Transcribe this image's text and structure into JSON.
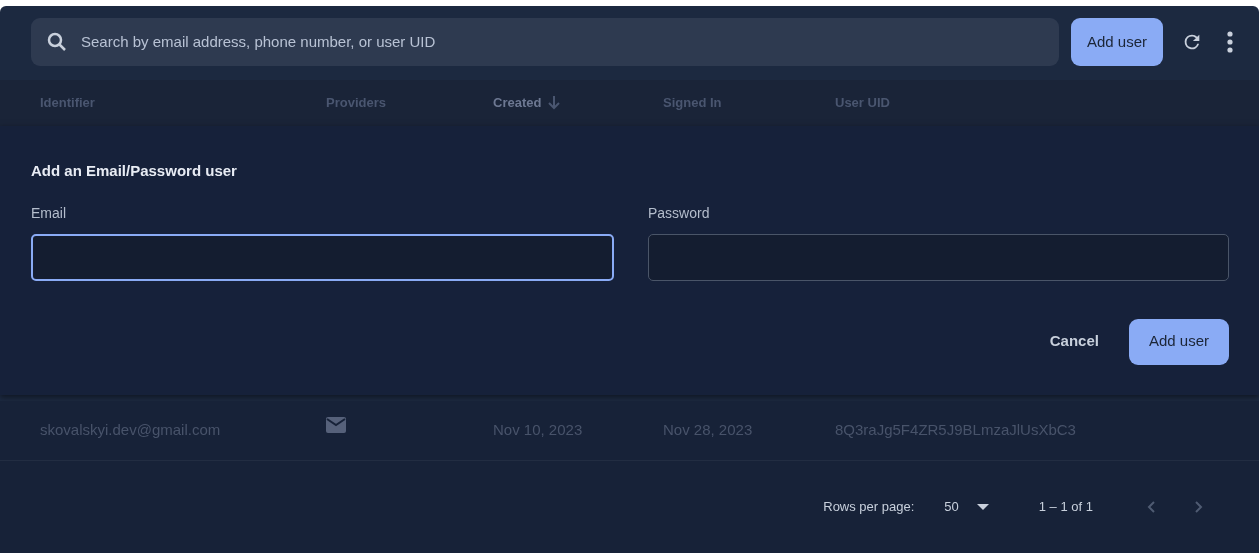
{
  "search": {
    "placeholder": "Search by email address, phone number, or user UID"
  },
  "toolbar": {
    "add_button": "Add user"
  },
  "table": {
    "columns": [
      {
        "label": "Identifier",
        "sorted": false
      },
      {
        "label": "Providers",
        "sorted": false
      },
      {
        "label": "Created",
        "sorted": true
      },
      {
        "label": "Signed In",
        "sorted": false
      },
      {
        "label": "User UID",
        "sorted": false
      }
    ],
    "rows": [
      {
        "identifier": "skovalskyi.dev@gmail.com",
        "providers": [
          {
            "kind": "email"
          }
        ],
        "created": "Nov 10, 2023",
        "signed_in": "Nov 28, 2023",
        "uid": "8Q3raJg5F4ZR5J9BLmzaJlUsXbC3"
      }
    ]
  },
  "add_user_form": {
    "title": "Add an Email/Password user",
    "fields": [
      {
        "label": "Email",
        "focused": true
      },
      {
        "label": "Password",
        "focused": false
      }
    ],
    "cancel": "Cancel",
    "submit": "Add user"
  },
  "pagination": {
    "rows_per_page_label": "Rows per page:",
    "rows_per_page": "50",
    "range": "1 – 1 of 1"
  }
}
